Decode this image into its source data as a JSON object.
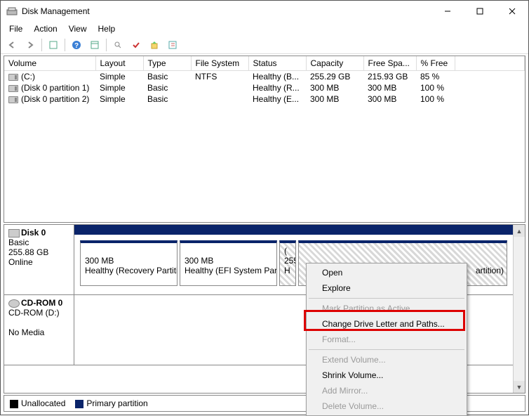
{
  "window": {
    "title": "Disk Management"
  },
  "menu": {
    "file": "File",
    "action": "Action",
    "view": "View",
    "help": "Help"
  },
  "columns": {
    "volume": "Volume",
    "layout": "Layout",
    "type": "Type",
    "fs": "File System",
    "status": "Status",
    "capacity": "Capacity",
    "free": "Free Spa...",
    "pct": "% Free"
  },
  "volumes": [
    {
      "name": "(C:)",
      "layout": "Simple",
      "type": "Basic",
      "fs": "NTFS",
      "status": "Healthy (B...",
      "capacity": "255.29 GB",
      "free": "215.93 GB",
      "pct": "85 %"
    },
    {
      "name": "(Disk 0 partition 1)",
      "layout": "Simple",
      "type": "Basic",
      "fs": "",
      "status": "Healthy (R...",
      "capacity": "300 MB",
      "free": "300 MB",
      "pct": "100 %"
    },
    {
      "name": "(Disk 0 partition 2)",
      "layout": "Simple",
      "type": "Basic",
      "fs": "",
      "status": "Healthy (E...",
      "capacity": "300 MB",
      "free": "300 MB",
      "pct": "100 %"
    }
  ],
  "disk0": {
    "name": "Disk 0",
    "type": "Basic",
    "size": "255.88 GB",
    "status": "Online",
    "parts": [
      {
        "line1": "300 MB",
        "line2": "Healthy (Recovery Partition)"
      },
      {
        "line1": "300 MB",
        "line2": "Healthy (EFI System Partition)"
      },
      {
        "line1": "(",
        "line2": "255",
        "line3": "H"
      },
      {
        "line2": "artition)"
      }
    ]
  },
  "cdrom": {
    "name": "CD-ROM 0",
    "sub": "CD-ROM (D:)",
    "status": "No Media"
  },
  "legend": {
    "unallocated": "Unallocated",
    "primary": "Primary partition"
  },
  "context": {
    "open": "Open",
    "explore": "Explore",
    "mark": "Mark Partition as Active",
    "change": "Change Drive Letter and Paths...",
    "format": "Format...",
    "extend": "Extend Volume...",
    "shrink": "Shrink Volume...",
    "mirror": "Add Mirror...",
    "delete": "Delete Volume..."
  }
}
